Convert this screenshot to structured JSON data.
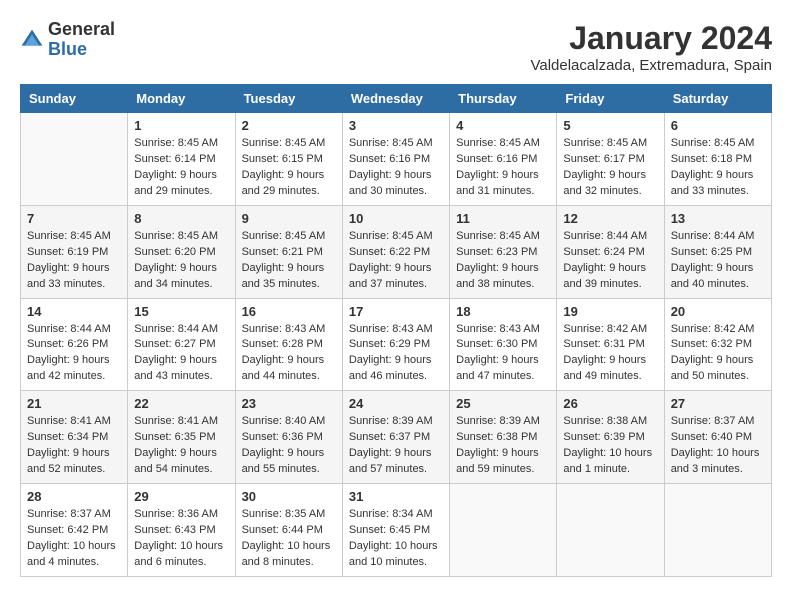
{
  "logo": {
    "general": "General",
    "blue": "Blue"
  },
  "header": {
    "month": "January 2024",
    "location": "Valdelacalzada, Extremadura, Spain"
  },
  "weekdays": [
    "Sunday",
    "Monday",
    "Tuesday",
    "Wednesday",
    "Thursday",
    "Friday",
    "Saturday"
  ],
  "weeks": [
    [
      {
        "day": "",
        "content": ""
      },
      {
        "day": "1",
        "content": "Sunrise: 8:45 AM\nSunset: 6:14 PM\nDaylight: 9 hours\nand 29 minutes."
      },
      {
        "day": "2",
        "content": "Sunrise: 8:45 AM\nSunset: 6:15 PM\nDaylight: 9 hours\nand 29 minutes."
      },
      {
        "day": "3",
        "content": "Sunrise: 8:45 AM\nSunset: 6:16 PM\nDaylight: 9 hours\nand 30 minutes."
      },
      {
        "day": "4",
        "content": "Sunrise: 8:45 AM\nSunset: 6:16 PM\nDaylight: 9 hours\nand 31 minutes."
      },
      {
        "day": "5",
        "content": "Sunrise: 8:45 AM\nSunset: 6:17 PM\nDaylight: 9 hours\nand 32 minutes."
      },
      {
        "day": "6",
        "content": "Sunrise: 8:45 AM\nSunset: 6:18 PM\nDaylight: 9 hours\nand 33 minutes."
      }
    ],
    [
      {
        "day": "7",
        "content": "Sunrise: 8:45 AM\nSunset: 6:19 PM\nDaylight: 9 hours\nand 33 minutes."
      },
      {
        "day": "8",
        "content": "Sunrise: 8:45 AM\nSunset: 6:20 PM\nDaylight: 9 hours\nand 34 minutes."
      },
      {
        "day": "9",
        "content": "Sunrise: 8:45 AM\nSunset: 6:21 PM\nDaylight: 9 hours\nand 35 minutes."
      },
      {
        "day": "10",
        "content": "Sunrise: 8:45 AM\nSunset: 6:22 PM\nDaylight: 9 hours\nand 37 minutes."
      },
      {
        "day": "11",
        "content": "Sunrise: 8:45 AM\nSunset: 6:23 PM\nDaylight: 9 hours\nand 38 minutes."
      },
      {
        "day": "12",
        "content": "Sunrise: 8:44 AM\nSunset: 6:24 PM\nDaylight: 9 hours\nand 39 minutes."
      },
      {
        "day": "13",
        "content": "Sunrise: 8:44 AM\nSunset: 6:25 PM\nDaylight: 9 hours\nand 40 minutes."
      }
    ],
    [
      {
        "day": "14",
        "content": "Sunrise: 8:44 AM\nSunset: 6:26 PM\nDaylight: 9 hours\nand 42 minutes."
      },
      {
        "day": "15",
        "content": "Sunrise: 8:44 AM\nSunset: 6:27 PM\nDaylight: 9 hours\nand 43 minutes."
      },
      {
        "day": "16",
        "content": "Sunrise: 8:43 AM\nSunset: 6:28 PM\nDaylight: 9 hours\nand 44 minutes."
      },
      {
        "day": "17",
        "content": "Sunrise: 8:43 AM\nSunset: 6:29 PM\nDaylight: 9 hours\nand 46 minutes."
      },
      {
        "day": "18",
        "content": "Sunrise: 8:43 AM\nSunset: 6:30 PM\nDaylight: 9 hours\nand 47 minutes."
      },
      {
        "day": "19",
        "content": "Sunrise: 8:42 AM\nSunset: 6:31 PM\nDaylight: 9 hours\nand 49 minutes."
      },
      {
        "day": "20",
        "content": "Sunrise: 8:42 AM\nSunset: 6:32 PM\nDaylight: 9 hours\nand 50 minutes."
      }
    ],
    [
      {
        "day": "21",
        "content": "Sunrise: 8:41 AM\nSunset: 6:34 PM\nDaylight: 9 hours\nand 52 minutes."
      },
      {
        "day": "22",
        "content": "Sunrise: 8:41 AM\nSunset: 6:35 PM\nDaylight: 9 hours\nand 54 minutes."
      },
      {
        "day": "23",
        "content": "Sunrise: 8:40 AM\nSunset: 6:36 PM\nDaylight: 9 hours\nand 55 minutes."
      },
      {
        "day": "24",
        "content": "Sunrise: 8:39 AM\nSunset: 6:37 PM\nDaylight: 9 hours\nand 57 minutes."
      },
      {
        "day": "25",
        "content": "Sunrise: 8:39 AM\nSunset: 6:38 PM\nDaylight: 9 hours\nand 59 minutes."
      },
      {
        "day": "26",
        "content": "Sunrise: 8:38 AM\nSunset: 6:39 PM\nDaylight: 10 hours\nand 1 minute."
      },
      {
        "day": "27",
        "content": "Sunrise: 8:37 AM\nSunset: 6:40 PM\nDaylight: 10 hours\nand 3 minutes."
      }
    ],
    [
      {
        "day": "28",
        "content": "Sunrise: 8:37 AM\nSunset: 6:42 PM\nDaylight: 10 hours\nand 4 minutes."
      },
      {
        "day": "29",
        "content": "Sunrise: 8:36 AM\nSunset: 6:43 PM\nDaylight: 10 hours\nand 6 minutes."
      },
      {
        "day": "30",
        "content": "Sunrise: 8:35 AM\nSunset: 6:44 PM\nDaylight: 10 hours\nand 8 minutes."
      },
      {
        "day": "31",
        "content": "Sunrise: 8:34 AM\nSunset: 6:45 PM\nDaylight: 10 hours\nand 10 minutes."
      },
      {
        "day": "",
        "content": ""
      },
      {
        "day": "",
        "content": ""
      },
      {
        "day": "",
        "content": ""
      }
    ]
  ]
}
